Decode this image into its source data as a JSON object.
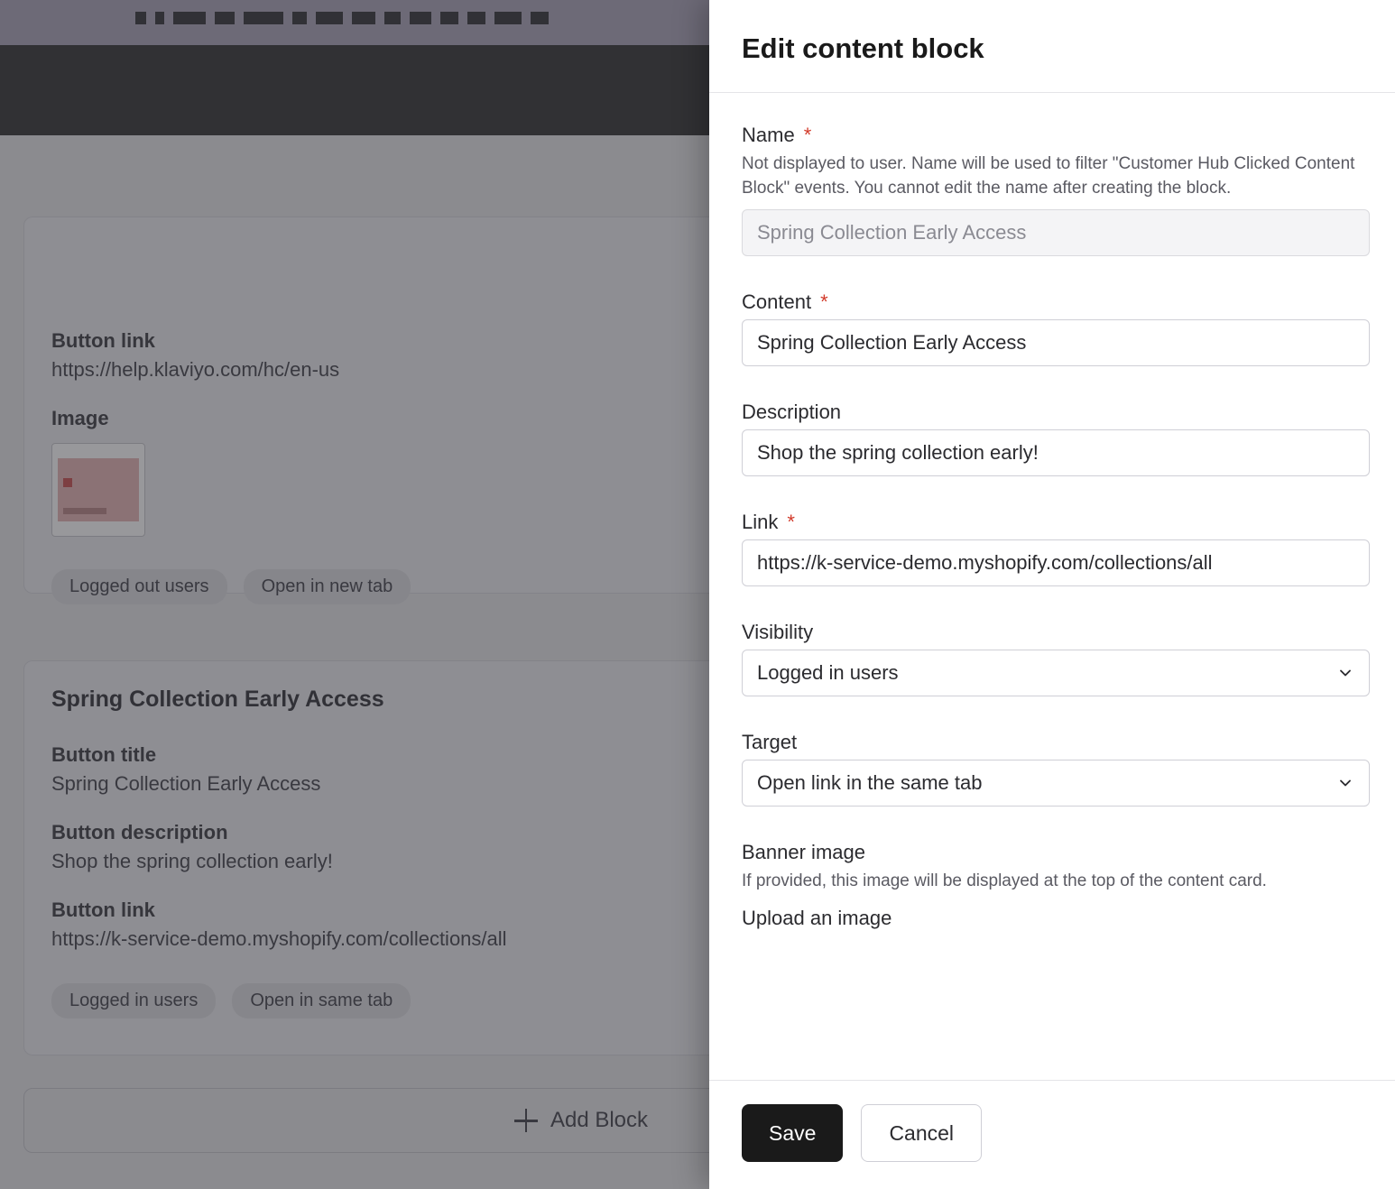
{
  "background": {
    "card1": {
      "button_link_label": "Button link",
      "button_link_value": "https://help.klaviyo.com/hc/en-us",
      "image_label": "Image",
      "tags": [
        "Logged out users",
        "Open in new tab"
      ]
    },
    "card2": {
      "title": "Spring Collection Early Access",
      "button_title_label": "Button title",
      "button_title_value": "Spring Collection Early Access",
      "button_desc_label": "Button description",
      "button_desc_value": "Shop the spring collection early!",
      "button_link_label": "Button link",
      "button_link_value": "https://k-service-demo.myshopify.com/collections/all",
      "tags": [
        "Logged in users",
        "Open in same tab"
      ]
    },
    "add_block_label": "Add Block"
  },
  "drawer": {
    "title": "Edit content block",
    "name": {
      "label": "Name",
      "helper": "Not displayed to user. Name will be used to filter \"Customer Hub Clicked Content Block\" events. You cannot edit the name after creating the block.",
      "value": "Spring Collection Early Access"
    },
    "content": {
      "label": "Content",
      "value": "Spring Collection Early Access"
    },
    "description": {
      "label": "Description",
      "value": "Shop the spring collection early!"
    },
    "link": {
      "label": "Link",
      "value": "https://k-service-demo.myshopify.com/collections/all"
    },
    "visibility": {
      "label": "Visibility",
      "value": "Logged in users"
    },
    "target": {
      "label": "Target",
      "value": "Open link in the same tab"
    },
    "banner": {
      "label": "Banner image",
      "helper": "If provided, this image will be displayed at the top of the content card.",
      "upload_label": "Upload an image"
    },
    "footer": {
      "save": "Save",
      "cancel": "Cancel"
    }
  }
}
